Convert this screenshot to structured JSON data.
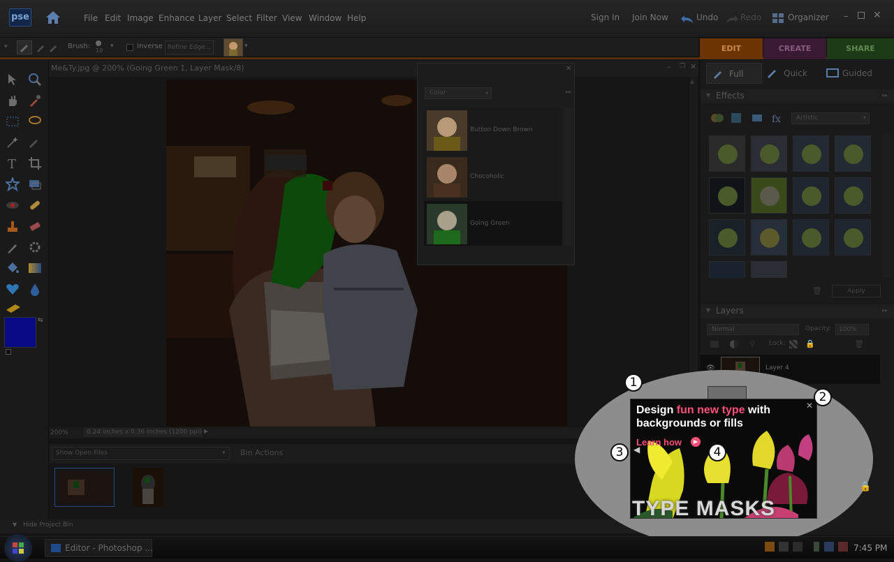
{
  "app": {
    "logo": "pse",
    "menu": [
      "File",
      "Edit",
      "Image",
      "Enhance",
      "Layer",
      "Select",
      "Filter",
      "View",
      "Window",
      "Help"
    ],
    "sign_in": "Sign In",
    "join_now": "Join Now",
    "undo": "Undo",
    "redo": "Redo",
    "organizer": "Organizer"
  },
  "options": {
    "brush_label": "Brush:",
    "brush_size": "10",
    "inverse_label": "Inverse",
    "refine_edge": "Refine Edge..."
  },
  "mode_tabs": [
    {
      "label": "EDIT",
      "color": "#6b3400"
    },
    {
      "label": "CREATE",
      "color": "#3a1a33"
    },
    {
      "label": "SHARE",
      "color": "#1d3a17"
    }
  ],
  "view_tabs": [
    "Full",
    "Quick",
    "Guided"
  ],
  "document": {
    "title": "Me&Ty.jpg @ 200% (Going Green 1, Layer Mask/8)",
    "zoom": "200%",
    "size_info": "0.24 inches x 0.36 inches (1200 ppi)"
  },
  "style_panel": {
    "dropdown": "Color",
    "items": [
      {
        "label": "Button Down Brown"
      },
      {
        "label": "Chocoholic"
      },
      {
        "label": "Going Green"
      }
    ]
  },
  "effects": {
    "title": "Effects",
    "category": "Artistic",
    "apply": "Apply"
  },
  "layers": {
    "title": "Layers",
    "blend_mode": "Normal",
    "opacity_label": "Opacity:",
    "opacity_value": "100%",
    "lock_label": "Lock:",
    "rows": [
      {
        "name": "Layer 4"
      }
    ]
  },
  "project_bin": {
    "show": "Show Open Files",
    "actions": "Bin Actions",
    "hide": "Hide Project Bin"
  },
  "ad": {
    "line1_pre": "Design ",
    "line1_highlight": "fun new type",
    "line1_post": " with",
    "line2": "backgrounds or fills",
    "link": "Learn how",
    "banner": "TYPE MASKS",
    "highlight_color": "#ff4f7a"
  },
  "callouts": [
    "1",
    "2",
    "3",
    "4"
  ],
  "taskbar": {
    "app": "Editor - Photoshop ...",
    "time": "7:45 PM"
  },
  "colors": {
    "foreground": "#0a0a86",
    "background": "#e0e0e0"
  }
}
